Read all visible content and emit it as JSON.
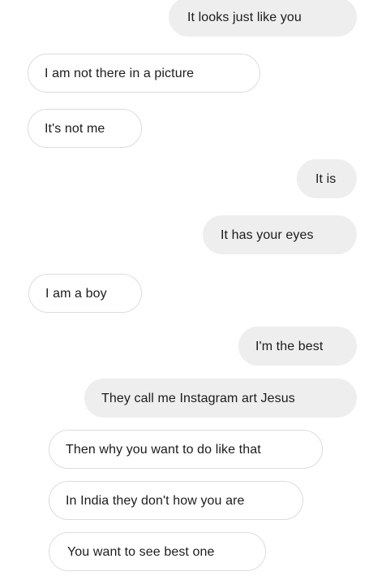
{
  "conversation": {
    "messages": [
      {
        "from": "sent",
        "text": "It looks just like you"
      },
      {
        "from": "received",
        "text": "I am not there in a picture"
      },
      {
        "from": "received",
        "text": "It's not me"
      },
      {
        "from": "sent",
        "text": "It is"
      },
      {
        "from": "sent",
        "text": "It has your eyes"
      },
      {
        "from": "received",
        "text": "I am a boy"
      },
      {
        "from": "sent",
        "text": "I'm the best"
      },
      {
        "from": "sent",
        "text": "They call me Instagram art Jesus"
      },
      {
        "from": "received",
        "text": "Then why you want to do like that"
      },
      {
        "from": "received",
        "text": "In India they don't how you are"
      },
      {
        "from": "received",
        "text": "You want to see best one"
      }
    ]
  },
  "colors": {
    "sent_bubble": "#eeeeee",
    "received_bubble": "#ffffff",
    "received_border": "#dcdcdc",
    "text": "#1c1c1c"
  }
}
